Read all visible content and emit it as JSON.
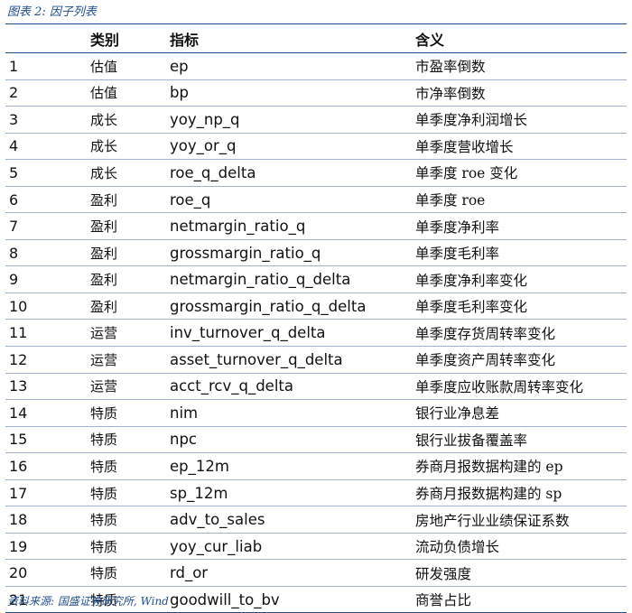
{
  "caption": "图表 2:  因子列表",
  "table": {
    "headers": [
      "类别",
      "指标",
      "含义"
    ],
    "rows": [
      {
        "idx": "1",
        "category": "估值",
        "indicator": "ep",
        "meaning": "市盈率倒数"
      },
      {
        "idx": "2",
        "category": "估值",
        "indicator": "bp",
        "meaning": "市净率倒数"
      },
      {
        "idx": "3",
        "category": "成长",
        "indicator": "yoy_np_q",
        "meaning": "单季度净利润增长"
      },
      {
        "idx": "4",
        "category": "成长",
        "indicator": "yoy_or_q",
        "meaning": "单季度营收增长"
      },
      {
        "idx": "5",
        "category": "成长",
        "indicator": "roe_q_delta",
        "meaning": "单季度 roe 变化"
      },
      {
        "idx": "6",
        "category": "盈利",
        "indicator": "roe_q",
        "meaning": "单季度 roe"
      },
      {
        "idx": "7",
        "category": "盈利",
        "indicator": "netmargin_ratio_q",
        "meaning": "单季度净利率"
      },
      {
        "idx": "8",
        "category": "盈利",
        "indicator": "grossmargin_ratio_q",
        "meaning": "单季度毛利率"
      },
      {
        "idx": "9",
        "category": "盈利",
        "indicator": "netmargin_ratio_q_delta",
        "meaning": "单季度净利率变化"
      },
      {
        "idx": "10",
        "category": "盈利",
        "indicator": "grossmargin_ratio_q_delta",
        "meaning": "单季度毛利率变化"
      },
      {
        "idx": "11",
        "category": "运营",
        "indicator": "inv_turnover_q_delta",
        "meaning": "单季度存货周转率变化"
      },
      {
        "idx": "12",
        "category": "运营",
        "indicator": "asset_turnover_q_delta",
        "meaning": "单季度资产周转率变化"
      },
      {
        "idx": "13",
        "category": "运营",
        "indicator": "acct_rcv_q_delta",
        "meaning": "单季度应收账款周转率变化"
      },
      {
        "idx": "14",
        "category": "特质",
        "indicator": "nim",
        "meaning": "银行业净息差"
      },
      {
        "idx": "15",
        "category": "特质",
        "indicator": "npc",
        "meaning": "银行业拔备覆盖率"
      },
      {
        "idx": "16",
        "category": "特质",
        "indicator": "ep_12m",
        "meaning": "券商月报数据构建的 ep"
      },
      {
        "idx": "17",
        "category": "特质",
        "indicator": "sp_12m",
        "meaning": "券商月报数据构建的 sp"
      },
      {
        "idx": "18",
        "category": "特质",
        "indicator": "adv_to_sales",
        "meaning": "房地产行业业绩保证系数"
      },
      {
        "idx": "19",
        "category": "特质",
        "indicator": "yoy_cur_liab",
        "meaning": "流动负债增长"
      },
      {
        "idx": "20",
        "category": "特质",
        "indicator": "rd_or",
        "meaning": "研发强度"
      },
      {
        "idx": "21",
        "category": "特质",
        "indicator": "goodwill_to_bv",
        "meaning": "商誉占比"
      }
    ]
  },
  "source": "资料来源:  国盛证券研究所,  Wind",
  "colors": {
    "accent": "#1f4f8f",
    "row_divider": "#9fb3cf",
    "text": "#111111"
  }
}
